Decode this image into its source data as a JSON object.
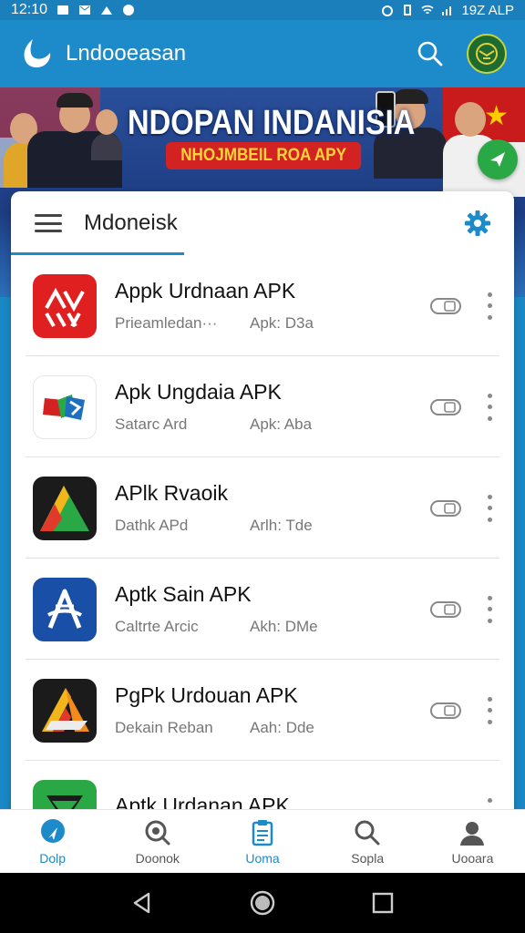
{
  "status_bar": {
    "time": "12:10",
    "right_text": "19Z ALP"
  },
  "app_bar": {
    "title": "Lndooeasan"
  },
  "banner": {
    "title": "NDOPAN INDANISIA",
    "subtitle": "NHOJMBEIL ROA APY"
  },
  "card": {
    "title": "Mdoneisk"
  },
  "apps": [
    {
      "name": "Appk Urdnaan APK",
      "meta1": "Prieamledan··· ",
      "meta2": "Apk: D3a",
      "icon": "red-arrows-icon"
    },
    {
      "name": "Apk Ungdaia APK",
      "meta1": "Satarc Ard",
      "meta2": "Apk: Aba",
      "icon": "flag-card-icon"
    },
    {
      "name": "APlk Rvaoik",
      "meta1": "Dathk APd",
      "meta2": "Arlh: Tde",
      "icon": "green-triangle-icon"
    },
    {
      "name": "Aptk Sain APK",
      "meta1": "Caltrte Arcic",
      "meta2": "Akh: DMe",
      "icon": "blue-a-icon"
    },
    {
      "name": "PgPk Urdouan APK",
      "meta1": "Dekain Reban",
      "meta2": "Aah: Dde",
      "icon": "multicolor-a-icon"
    },
    {
      "name": "Aptk Urdanan APK",
      "meta1": "",
      "meta2": "",
      "icon": "green-x-icon"
    }
  ],
  "bottom_nav": [
    {
      "label": "Dolp",
      "icon": "home-pin-icon",
      "active": true
    },
    {
      "label": "Doonok",
      "icon": "discover-icon",
      "active": false
    },
    {
      "label": "Uoma",
      "icon": "clipboard-icon",
      "active": false
    },
    {
      "label": "Sopla",
      "icon": "search-icon",
      "active": false
    },
    {
      "label": "Uooara",
      "icon": "profile-icon",
      "active": false
    }
  ],
  "colors": {
    "primary": "#1d8bc9",
    "banner_red": "#d32222",
    "fab_green": "#2aa845"
  }
}
